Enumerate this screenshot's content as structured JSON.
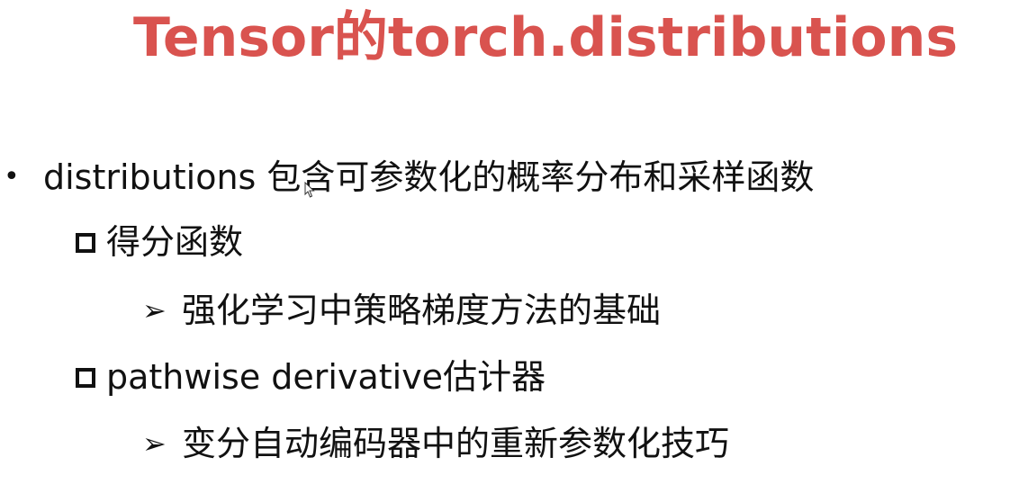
{
  "slide": {
    "title": "Tensor的torch.distributions",
    "bullets": [
      {
        "marker": "•",
        "text": "distributions 包含可参数化的概率分布和采样函数"
      },
      {
        "marker": "square",
        "text": "得分函数"
      },
      {
        "marker": "➢",
        "text": "强化学习中策略梯度方法的基础"
      },
      {
        "marker": "square",
        "text": "pathwise derivative估计器"
      },
      {
        "marker": "➢",
        "text": "变分自动编码器中的重新参数化技巧"
      }
    ]
  },
  "colors": {
    "title": "#d9534f",
    "text": "#111111",
    "background": "#ffffff"
  },
  "icons": {
    "level1": "bullet-dot-icon",
    "level2": "square-bullet-icon",
    "level3": "arrow-bullet-icon",
    "pointer": "mouse-cursor-icon"
  }
}
